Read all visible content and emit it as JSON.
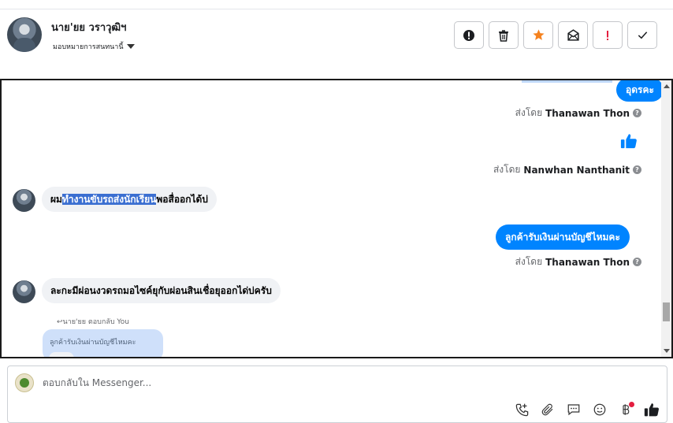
{
  "header": {
    "contact_name": "นาย'ยย วราวุฒิฯ",
    "assign_label": "มอบหมายการสนทนานี้"
  },
  "toolbar": {
    "buttons": [
      "info-icon",
      "trash-icon",
      "star-icon",
      "mail-icon",
      "exclamation-icon",
      "check-icon"
    ],
    "colors": {
      "star": "#f5821f",
      "exclamation": "#e41e3f"
    }
  },
  "messages": {
    "out1": {
      "text": "อุดรคะ"
    },
    "sent1": {
      "prefix": "ส่งโดย",
      "name": "Thanawan Thon"
    },
    "sent2": {
      "prefix": "ส่งโดย",
      "name": "Nanwhan Nanthanit"
    },
    "in1": {
      "pre": "ผม",
      "selected": "ทำงานขับรถส่งนักเรียน",
      "post": "พอสื่ออกได้บ่"
    },
    "out2": {
      "text": "ลูกค้ารับเงินผ่านบัญชีไหมคะ"
    },
    "sent3": {
      "prefix": "ส่งโดย",
      "name": "Thanawan Thon"
    },
    "in2": {
      "text": "ละกะมีผ่อนงวดรถมอไซค์ยุกับผ่อนสินเชื่อยุออกได่บ่ครับ"
    },
    "reply": {
      "label": "นาย'ยย ตอบกลับ You",
      "quote": "ลูกค้ารับเงินผ่านบัญชีไหมคะ"
    }
  },
  "composer": {
    "placeholder": "ตอบกลับใน Messenger..."
  },
  "colors": {
    "accent": "#0084ff",
    "incoming": "#f0f2f5",
    "selection": "#3b6fd1"
  }
}
